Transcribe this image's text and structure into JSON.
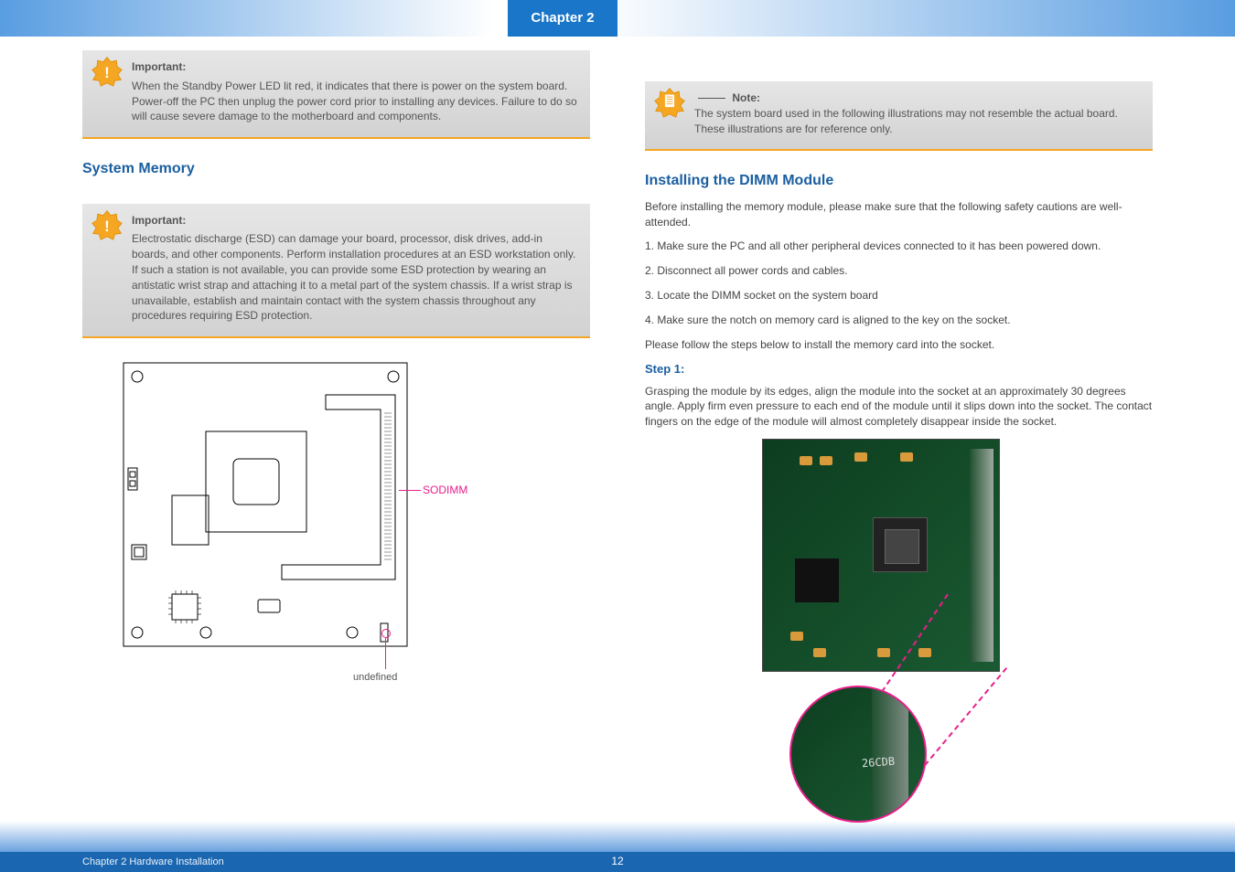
{
  "chapter_tab": "Chapter 2",
  "footer": {
    "page_number": "12",
    "chapter_label": "Chapter 2 Hardware Installation"
  },
  "left_column": {
    "important1": {
      "title": "Important:",
      "text": "When the Standby Power LED lit red, it indicates that there is power on the system board. Power-off the PC then unplug the power cord prior to installing any devices. Failure to do so will cause severe damage to the motherboard and components."
    },
    "heading_memory": "System Memory",
    "important2": {
      "title": "Important:",
      "text": "Electrostatic discharge (ESD) can damage your board, processor, disk drives, add-in boards, and other components. Perform installation procedures at an ESD workstation only. If such a station is not available, you can provide some ESD protection by wearing an antistatic wrist strap and attaching it to a metal part of the system chassis. If a wrist strap is unavailable, establish and maintain contact with the system chassis throughout any procedures requiring ESD protection."
    },
    "diagram": {
      "sodimm_label": "SODIMM",
      "undefined_label": "undefined"
    }
  },
  "right_column": {
    "note": {
      "title": "Note:",
      "text": "The system board used in the following illustrations may not resemble the actual board. These illustrations are for reference only."
    },
    "heading_install": "Installing the DIMM Module",
    "para1": "Before installing the memory module, please make sure that the following safety cautions are well-attended.",
    "step1": "1. Make sure the PC and all other peripheral devices connected to it has been powered down.",
    "step2": "2. Disconnect all power cords and cables.",
    "step3": "3. Locate the DIMM socket on the system board",
    "step4": "4. Make sure the notch on memory card is aligned to the key on the socket.",
    "para2_a": "Please follow the steps below to install the memory card into the socket.",
    "step_heading": "Step 1:",
    "para2_b": "Grasping the module by its edges, align the module into the socket at an approximately 30 degrees angle. Apply firm even pressure to each end of the module until it slips down into the socket. The contact fingers on the edge of the module will almost completely disappear inside the socket.",
    "photo_label": "26CDB"
  }
}
